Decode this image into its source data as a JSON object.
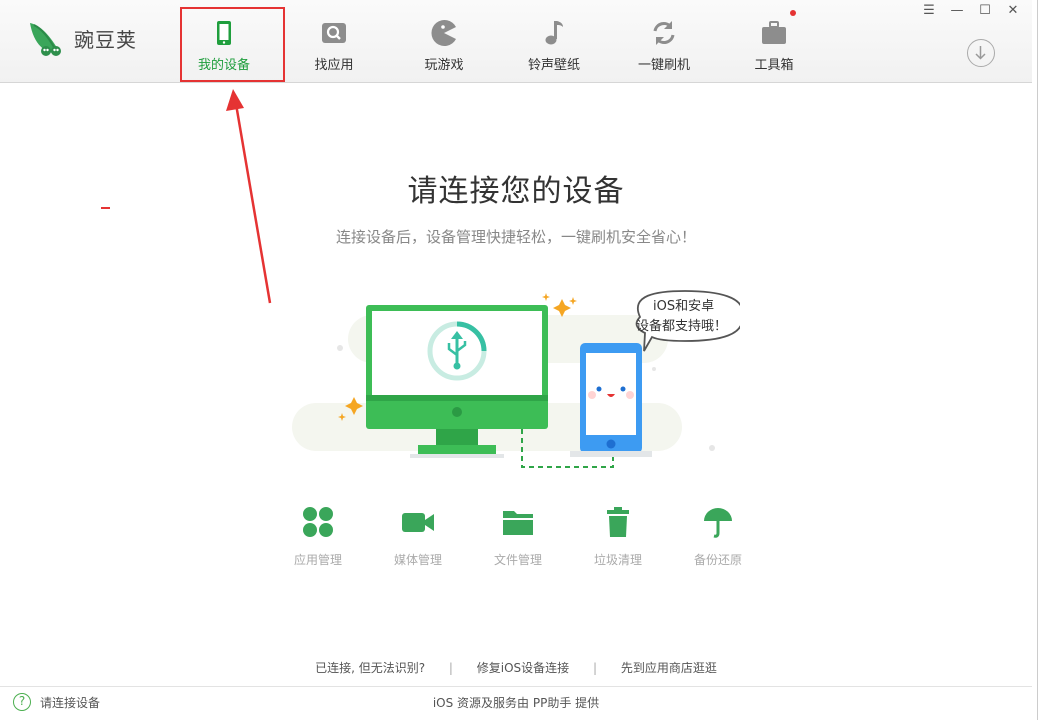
{
  "app": {
    "name": "豌豆荚"
  },
  "nav": {
    "items": [
      {
        "label": "我的设备",
        "icon": "phone-icon",
        "active": true
      },
      {
        "label": "找应用",
        "icon": "search-box-icon"
      },
      {
        "label": "玩游戏",
        "icon": "pacman-icon"
      },
      {
        "label": "铃声壁纸",
        "icon": "music-note-icon"
      },
      {
        "label": "一键刷机",
        "icon": "refresh-icon"
      },
      {
        "label": "工具箱",
        "icon": "toolbox-icon",
        "badge": true
      }
    ]
  },
  "window_controls": {
    "menu": "☰",
    "minimize": "—",
    "maximize": "☐",
    "close": "✕"
  },
  "main": {
    "title": "请连接您的设备",
    "subtitle": "连接设备后，设备管理快捷轻松，一键刷机安全省心！",
    "bubble_line1": "iOS和安卓",
    "bubble_line2": "设备都支持哦！"
  },
  "features": [
    {
      "label": "应用管理",
      "icon": "apps-grid-icon"
    },
    {
      "label": "媒体管理",
      "icon": "video-camera-icon"
    },
    {
      "label": "文件管理",
      "icon": "folder-icon"
    },
    {
      "label": "垃圾清理",
      "icon": "trash-icon"
    },
    {
      "label": "备份还原",
      "icon": "umbrella-icon"
    }
  ],
  "help_links": [
    {
      "label": "已连接, 但无法识别?"
    },
    {
      "label": "修复iOS设备连接"
    },
    {
      "label": "先到应用商店逛逛"
    }
  ],
  "status": {
    "text": "请连接设备",
    "credit": "iOS 资源及服务由 PP助手 提供"
  },
  "colors": {
    "brand_green": "#1f9e3d",
    "highlight_red": "#e53333",
    "device_blue": "#3d9bf2"
  }
}
